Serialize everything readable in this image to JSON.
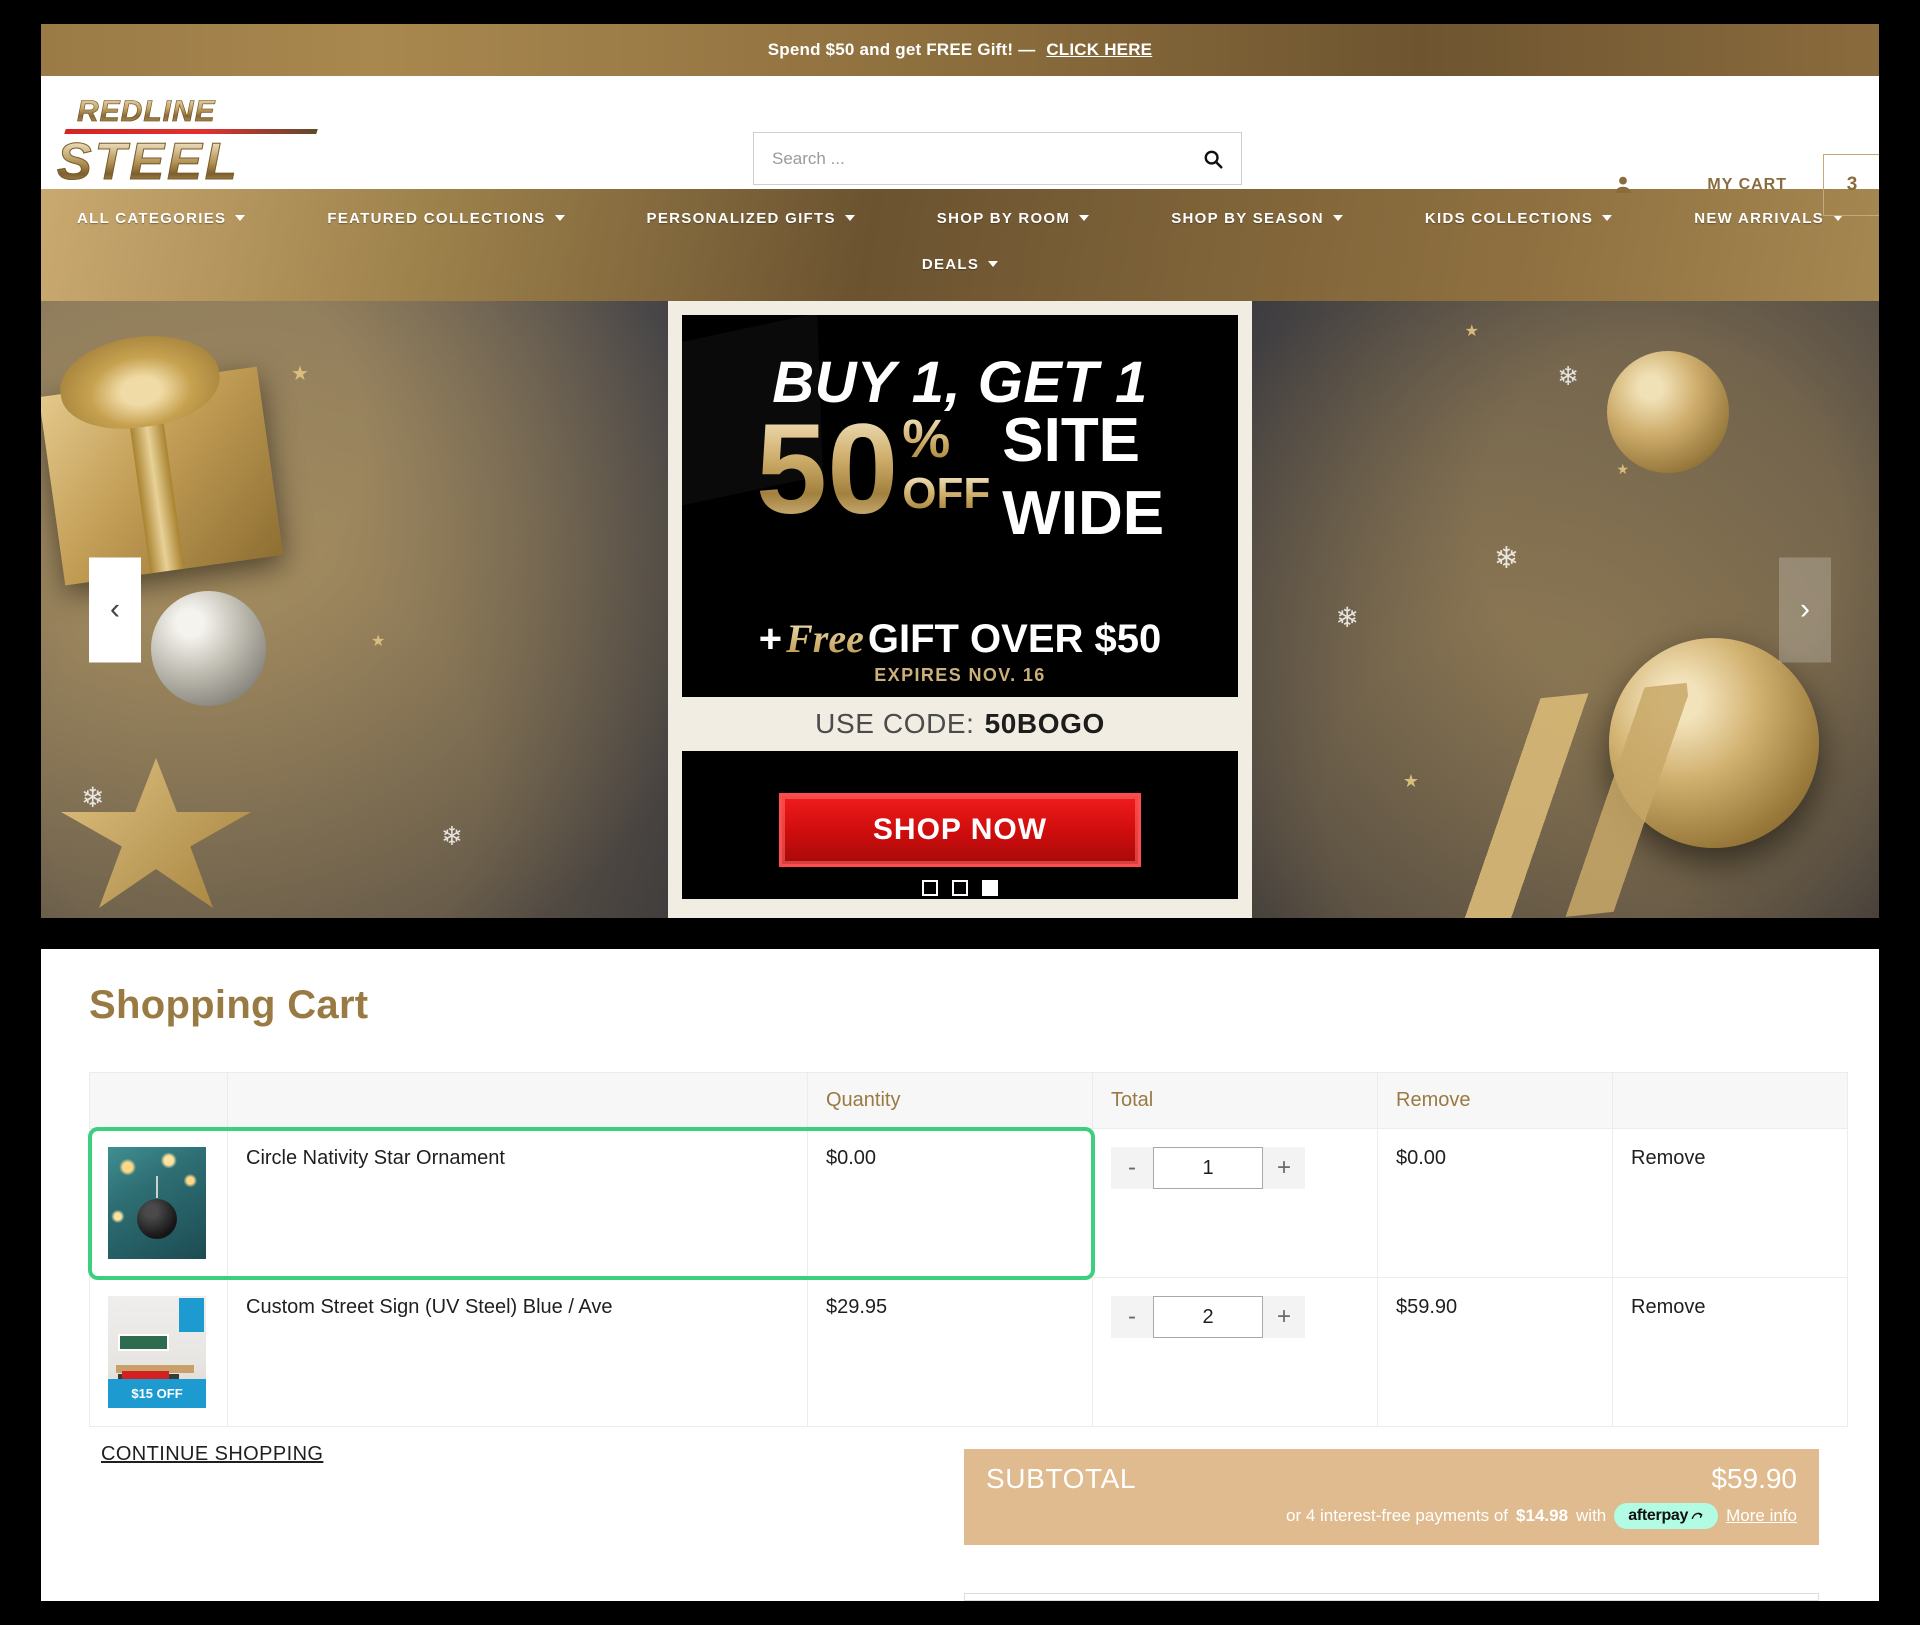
{
  "promo": {
    "text": "Spend $50 and get FREE Gift! —",
    "link": "CLICK HERE"
  },
  "brand": {
    "line1": "REDLINE",
    "line2": "STEEL"
  },
  "search": {
    "placeholder": "Search ...",
    "value": ""
  },
  "account": {
    "my_cart_label": "MY CART",
    "cart_count": "3"
  },
  "nav": {
    "row1": [
      {
        "label": "ALL CATEGORIES",
        "caret": true
      },
      {
        "label": "FEATURED COLLECTIONS",
        "caret": true
      },
      {
        "label": "PERSONALIZED GIFTS",
        "caret": true
      },
      {
        "label": "SHOP BY ROOM",
        "caret": true
      },
      {
        "label": "SHOP BY SEASON",
        "caret": true
      },
      {
        "label": "KIDS COLLECTIONS",
        "caret": true
      },
      {
        "label": "NEW ARRIVALS",
        "caret": true
      }
    ],
    "row2": [
      {
        "label": "DEALS",
        "caret": true
      }
    ]
  },
  "hero": {
    "headline_1": "BUY 1, GET 1",
    "discount": "50",
    "percent": "%",
    "off": "OFF",
    "site": "SITE",
    "wide": "WIDE",
    "gift_prefix": "+",
    "gift_free": "Free",
    "gift_rest": "GIFT OVER $50",
    "expires": "EXPIRES NOV. 16",
    "code_label": "USE CODE:",
    "code_value": "50BOGO",
    "cta": "SHOP NOW",
    "prev_arrow": "‹",
    "next_arrow": "›",
    "slides": 3,
    "active_slide": 3
  },
  "cart": {
    "title": "Shopping Cart",
    "columns": [
      "",
      "",
      "Quantity",
      "Total",
      "Remove",
      ""
    ],
    "headers": {
      "quantity": "Quantity",
      "total": "Total",
      "remove": "Remove"
    },
    "items": [
      {
        "name": "Circle Nativity Star Ornament",
        "price": "$0.00",
        "quantity": "1",
        "line_total": "$0.00",
        "remove_label": "Remove",
        "highlighted": true,
        "thumb": "ornament-thumbnail"
      },
      {
        "name": "Custom Street Sign (UV Steel) Blue / Ave",
        "price": "$29.95",
        "quantity": "2",
        "line_total": "$59.90",
        "remove_label": "Remove",
        "highlighted": false,
        "thumb": "street-sign-thumbnail",
        "thumb_badge": "$15 OFF"
      }
    ],
    "continue_shopping": "CONTINUE SHOPPING",
    "subtotal_label": "SUBTOTAL",
    "subtotal_value": "$59.90",
    "afterpay_prefix": "or 4 interest-free payments of",
    "afterpay_amount": "$14.98",
    "afterpay_with": "with",
    "afterpay_brand": "afterpay",
    "afterpay_more": "More info"
  },
  "qty_controls": {
    "minus": "-",
    "plus": "+"
  },
  "colors": {
    "brand_gold": "#9a7a43",
    "nav_gold": "#8a6c3c",
    "cta_red": "#cf0d0d",
    "subtotal_tan": "#dfbb8f",
    "highlight_green": "#3ecf7e",
    "afterpay_mint": "#b2fce4"
  }
}
